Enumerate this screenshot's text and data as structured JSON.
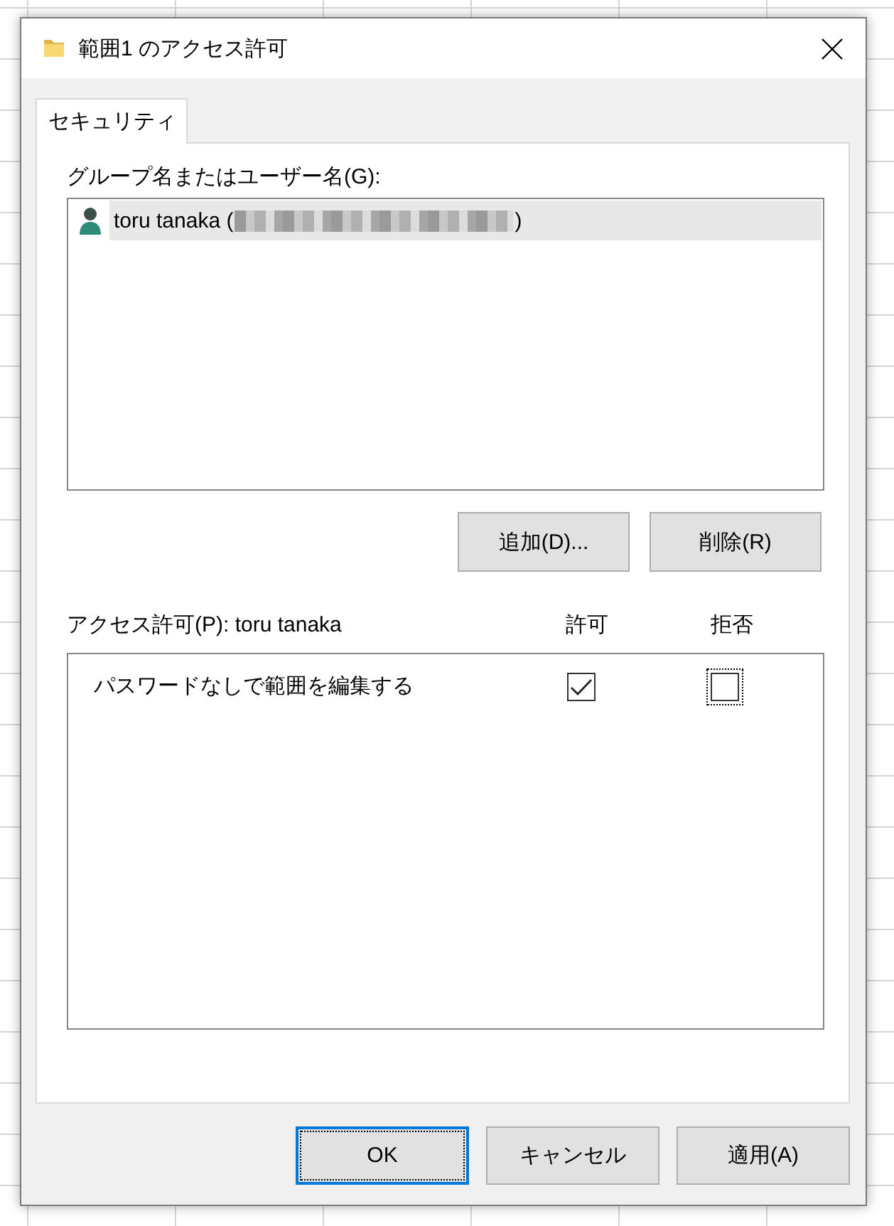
{
  "window": {
    "title": "範囲1 のアクセス許可"
  },
  "tabs": [
    {
      "label": "セキュリティ",
      "selected": true
    }
  ],
  "groups": {
    "label": "グループ名またはユーザー名(G):",
    "items": [
      {
        "name": "toru tanaka (",
        "suffix": ")",
        "redacted": true,
        "selected": true
      }
    ],
    "buttons": [
      "追加(D)...",
      "削除(R)"
    ]
  },
  "permissions": {
    "label": "アクセス許可(P): toru tanaka",
    "columns": [
      "許可",
      "拒否"
    ],
    "rows": [
      {
        "label": "パスワードなしで範囲を編集する",
        "allow": {
          "checked": true,
          "focused": false
        },
        "deny": {
          "checked": false,
          "focused": true
        }
      }
    ]
  },
  "buttons": [
    {
      "label": "OK",
      "default": true
    },
    {
      "label": "キャンセル",
      "default": false
    },
    {
      "label": "適用(A)",
      "default": false
    }
  ]
}
